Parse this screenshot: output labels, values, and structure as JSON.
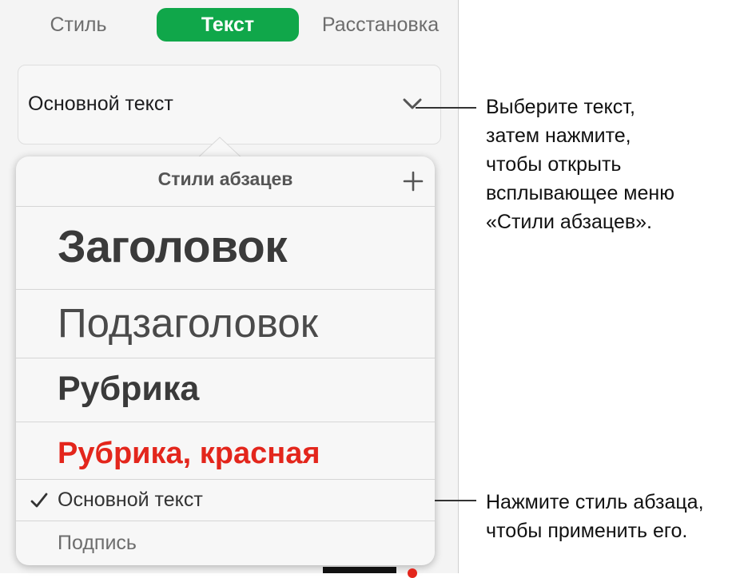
{
  "tabs": [
    {
      "label": "Стиль",
      "selected": false
    },
    {
      "label": "Текст",
      "selected": true
    },
    {
      "label": "Расстановка",
      "selected": false
    }
  ],
  "paragraph_style_button": {
    "label": "Основной текст",
    "icon": "chevron-down-icon"
  },
  "popover": {
    "title": "Стили абзацев",
    "add_icon": "plus-icon",
    "items": [
      {
        "label": "Заголовок"
      },
      {
        "label": "Подзаголовок"
      },
      {
        "label": "Рубрика"
      },
      {
        "label": "Рубрика, красная"
      },
      {
        "label": "Основной текст",
        "checked": true
      },
      {
        "label": "Подпись"
      }
    ]
  },
  "callouts": [
    {
      "text": "Выберите текст,\nзатем нажмите,\nчтобы открыть\nвсплывающее меню\n«Стили абзацев»."
    },
    {
      "text": "Нажмите стиль абзаца,\nчтобы применить его."
    }
  ],
  "colors": {
    "accent": "#10a74a",
    "red_style": "#e3261c"
  }
}
